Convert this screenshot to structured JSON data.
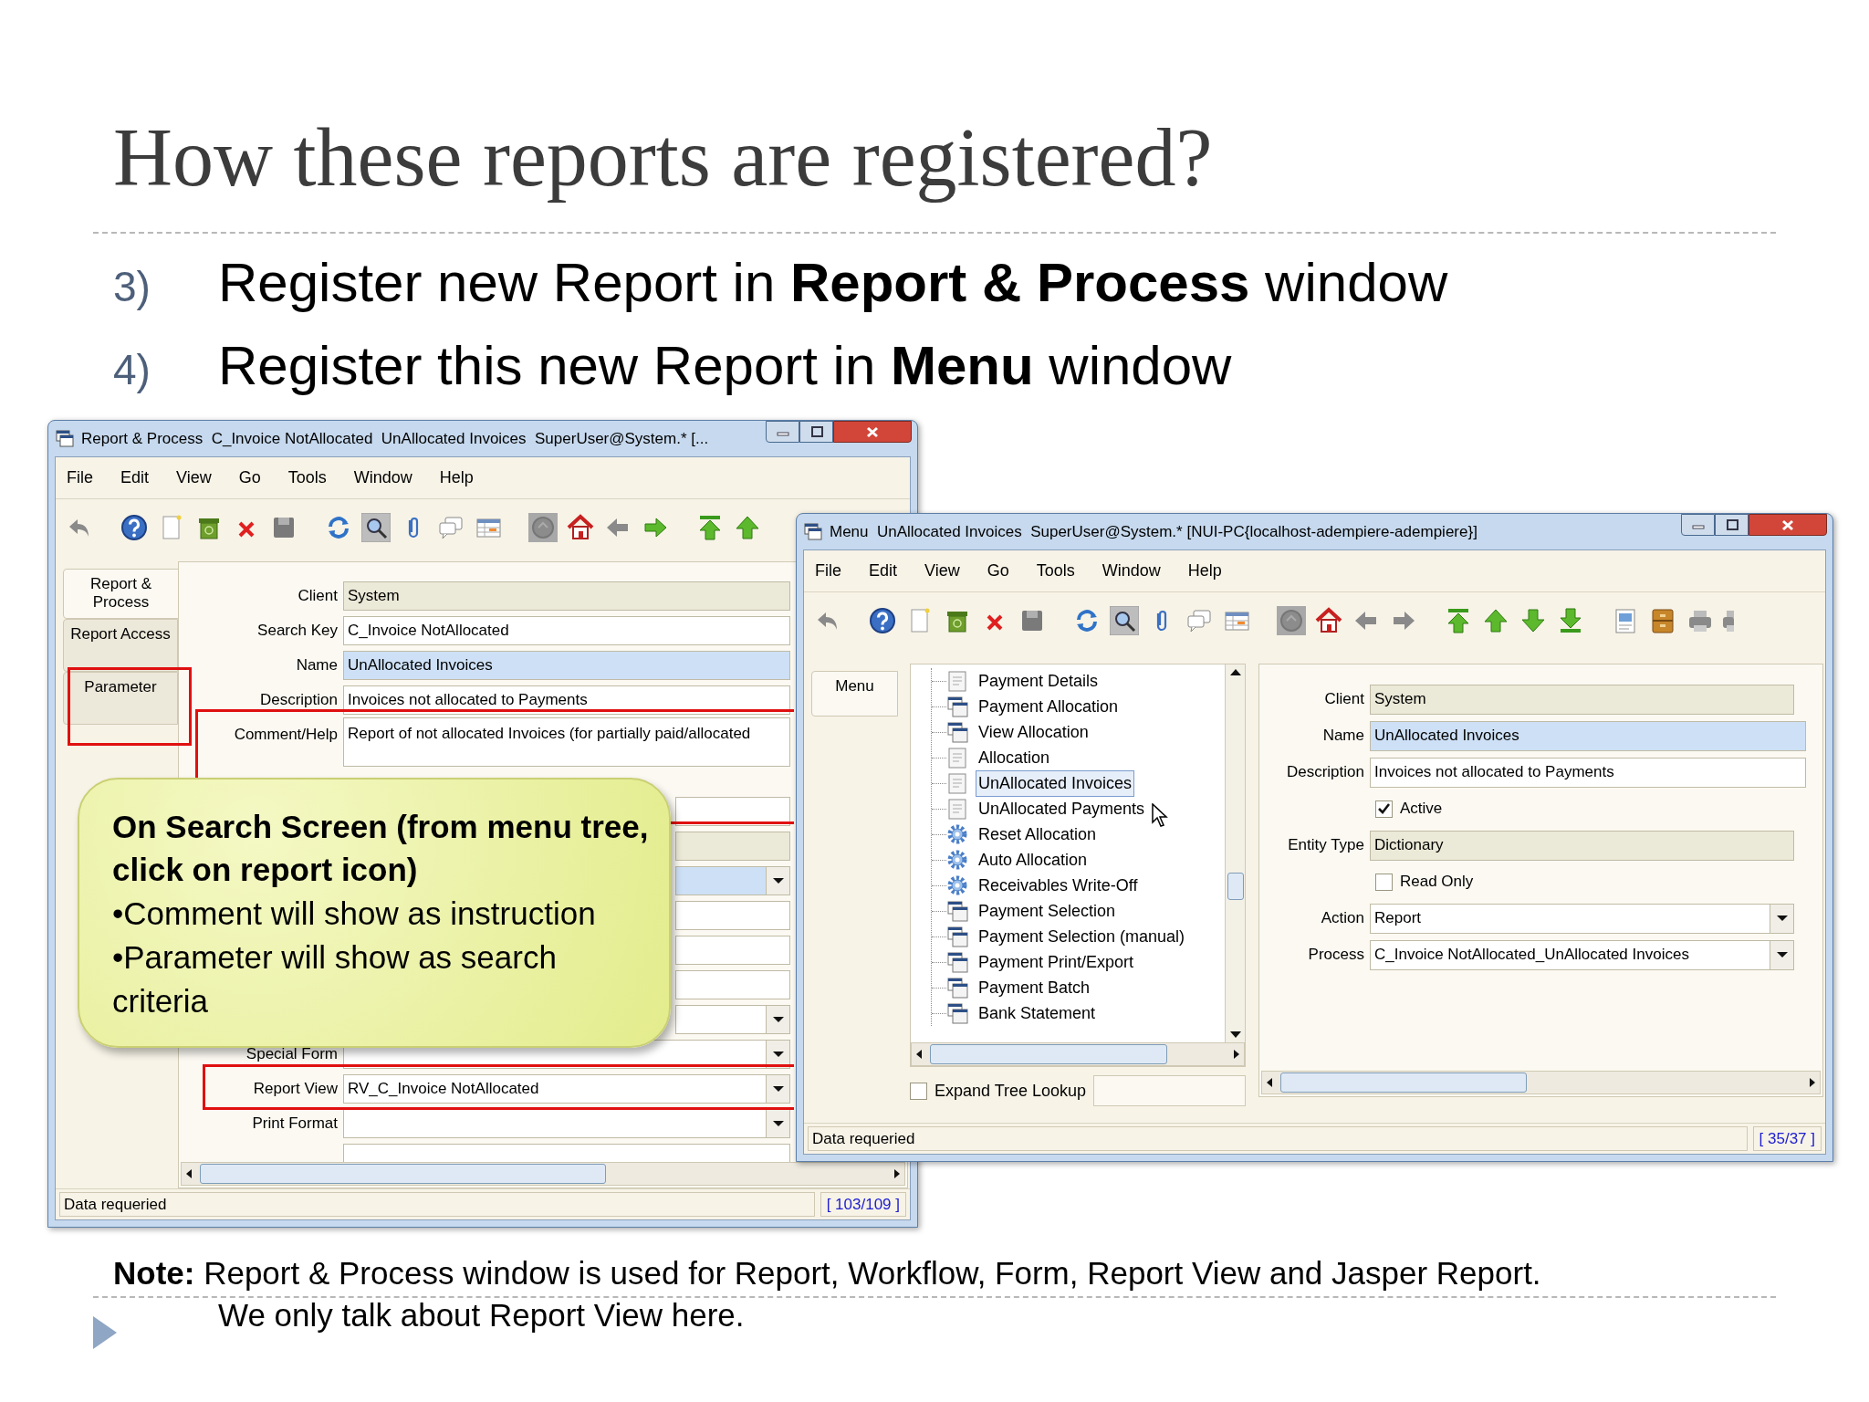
{
  "slide": {
    "title": "How these reports are registered?",
    "steps": [
      {
        "number": "3)",
        "text": "Register new Report in **Report & Process** window"
      },
      {
        "number": "4)",
        "text": "Register this new Report in **Menu** window"
      }
    ],
    "note": [
      "**Note:** Report & Process window is used for Report, Workflow, Form, Report View and Jasper Report.",
      "We only talk about Report View here."
    ]
  },
  "report_window": {
    "title": "Report & Process  C_Invoice NotAllocated  UnAllocated Invoices  SuperUser@System.* [...",
    "menu": [
      "File",
      "Edit",
      "View",
      "Go",
      "Tools",
      "Window",
      "Help"
    ],
    "tabs": [
      {
        "label": "Report & Process",
        "selected": true
      },
      {
        "label": "Report Access",
        "selected": false
      },
      {
        "label": "Parameter",
        "selected": false
      }
    ],
    "fields": [
      {
        "label": "Client",
        "kind": "text",
        "value": "System",
        "readonly": true,
        "mandatory": false
      },
      {
        "label": "Search Key",
        "kind": "text",
        "value": "C_Invoice NotAllocated",
        "readonly": false,
        "mandatory": false
      },
      {
        "label": "Name",
        "kind": "text",
        "value": "UnAllocated Invoices",
        "readonly": false,
        "mandatory": true
      },
      {
        "label": "Description",
        "kind": "text",
        "value": "Invoices not allocated to Payments",
        "readonly": false,
        "mandatory": false
      },
      {
        "label": "Comment/Help",
        "kind": "textarea",
        "value": "Report of not allocated Invoices (for partially paid/allocated",
        "readonly": false,
        "mandatory": false
      },
      {
        "kind": "text",
        "readonly": false,
        "mandatory": false
      },
      {
        "kind": "text",
        "readonly": true,
        "mandatory": false
      },
      {
        "kind": "dropdown",
        "readonly": false,
        "mandatory": true
      },
      {
        "kind": "text",
        "readonly": false,
        "mandatory": false
      },
      {
        "kind": "text",
        "readonly": false,
        "mandatory": false
      },
      {
        "kind": "text",
        "readonly": false,
        "mandatory": false
      },
      {
        "kind": "dropdown",
        "readonly": false,
        "mandatory": false
      },
      {
        "label": "Special Form",
        "kind": "dropdown",
        "readonly": false,
        "mandatory": false
      },
      {
        "label": "Report View",
        "kind": "dropdown",
        "value": "RV_C_Invoice NotAllocated",
        "readonly": false,
        "mandatory": false
      },
      {
        "label": "Print Format",
        "kind": "dropdown",
        "readonly": false,
        "mandatory": false
      },
      {
        "kind": "text",
        "readonly": false,
        "mandatory": false
      }
    ],
    "status": "Data requeried",
    "record": "[ 103/109 ]"
  },
  "callout": {
    "heading": "On Search Screen (from menu tree, click on report icon)",
    "bullets": [
      "•Comment will show as instruction",
      "•Parameter will show as search criteria"
    ]
  },
  "menu_window": {
    "title": "Menu  UnAllocated Invoices  SuperUser@System.* [NUI-PC{localhost-adempiere-adempiere}]",
    "menu": [
      "File",
      "Edit",
      "View",
      "Go",
      "Tools",
      "Window",
      "Help"
    ],
    "tabs": [
      {
        "label": "Menu",
        "selected": true
      }
    ],
    "tree": [
      {
        "label": "Payment Details",
        "kind": "report",
        "selected": false
      },
      {
        "label": "Payment Allocation",
        "kind": "window",
        "selected": false
      },
      {
        "label": "View Allocation",
        "kind": "window",
        "selected": false
      },
      {
        "label": "Allocation",
        "kind": "report",
        "selected": false
      },
      {
        "label": "UnAllocated Invoices",
        "kind": "report",
        "selected": true
      },
      {
        "label": "UnAllocated Payments",
        "kind": "report",
        "selected": false
      },
      {
        "label": "Reset Allocation",
        "kind": "process",
        "selected": false
      },
      {
        "label": "Auto Allocation",
        "kind": "process",
        "selected": false
      },
      {
        "label": "Receivables Write-Off",
        "kind": "process",
        "selected": false
      },
      {
        "label": "Payment Selection",
        "kind": "window",
        "selected": false
      },
      {
        "label": "Payment Selection (manual)",
        "kind": "window",
        "selected": false
      },
      {
        "label": "Payment Print/Export",
        "kind": "window",
        "selected": false
      },
      {
        "label": "Payment Batch",
        "kind": "window",
        "selected": false
      },
      {
        "label": "Bank Statement",
        "kind": "window",
        "selected": false
      }
    ],
    "expand_tree_lookup": {
      "label": "Expand Tree Lookup",
      "checked": false
    },
    "fields": [
      {
        "label": "Client",
        "kind": "text",
        "value": "System",
        "readonly": true,
        "mandatory": false
      },
      {
        "label": "Name",
        "kind": "text",
        "value": "UnAllocated Invoices",
        "readonly": false,
        "mandatory": true
      },
      {
        "label": "Description",
        "kind": "text",
        "value": "Invoices not allocated to Payments",
        "readonly": false,
        "mandatory": false
      },
      {
        "label": "Active",
        "kind": "checkbox",
        "checked": true
      },
      {
        "label": "Entity Type",
        "kind": "text",
        "value": "Dictionary",
        "readonly": true,
        "mandatory": false
      },
      {
        "label": "Read Only",
        "kind": "checkbox",
        "checked": false
      },
      {
        "label": "Action",
        "kind": "dropdown",
        "value": "Report",
        "readonly": false,
        "mandatory": false
      },
      {
        "label": "Process",
        "kind": "dropdown",
        "value": "C_Invoice NotAllocated_UnAllocated Invoices",
        "readonly": false,
        "mandatory": false
      }
    ],
    "status": "Data requeried",
    "record": "[ 35/37 ]"
  }
}
